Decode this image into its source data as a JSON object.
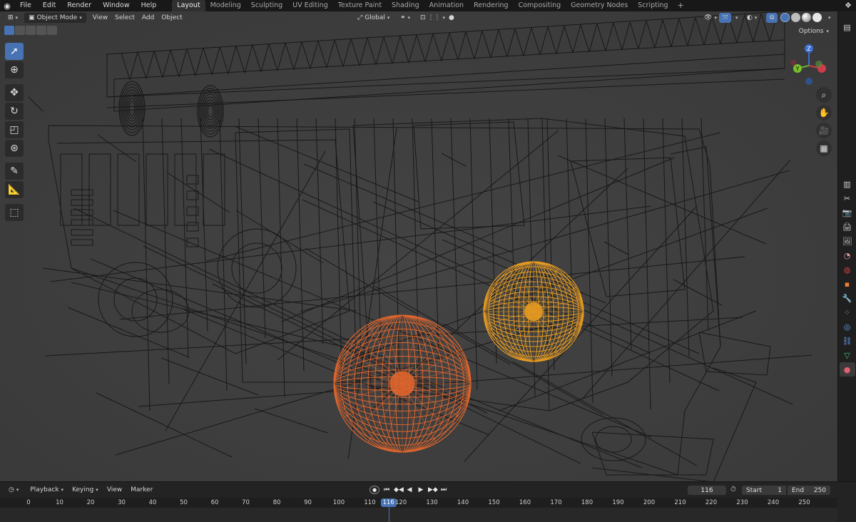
{
  "menu": {
    "items": [
      "File",
      "Edit",
      "Render",
      "Window",
      "Help"
    ]
  },
  "workspaces": {
    "tabs": [
      "Layout",
      "Modeling",
      "Sculpting",
      "UV Editing",
      "Texture Paint",
      "Shading",
      "Animation",
      "Rendering",
      "Compositing",
      "Geometry Nodes",
      "Scripting"
    ],
    "active": "Layout",
    "add_label": "+"
  },
  "viewport_header": {
    "mode_label": "Object Mode",
    "menus": [
      "View",
      "Select",
      "Add",
      "Object"
    ],
    "orientation_label": "Global",
    "options_label": "Options"
  },
  "gizmo": {
    "axis_z": "Z",
    "axis_y": "Y",
    "axis_x": "X"
  },
  "toolbar": {
    "tools": [
      "select-box",
      "cursor",
      "move",
      "rotate",
      "scale",
      "transform",
      "annotate",
      "measure",
      "add-cube"
    ],
    "active": "select-box"
  },
  "timeline": {
    "menus": [
      "Playback",
      "Keying",
      "View",
      "Marker"
    ],
    "current_frame": "116",
    "start_label": "Start",
    "start_value": "1",
    "end_label": "End",
    "end_value": "250",
    "ruler_ticks": [
      "0",
      "10",
      "20",
      "30",
      "40",
      "50",
      "60",
      "70",
      "80",
      "90",
      "100",
      "110",
      "120",
      "130",
      "140",
      "150",
      "160",
      "170",
      "180",
      "190",
      "200",
      "210",
      "220",
      "230",
      "240",
      "250"
    ],
    "playhead_label": "116"
  },
  "colors": {
    "accent": "#4772b3",
    "selected_orange": "#e8682c",
    "active_yellow": "#f0a020",
    "wire": "#111111",
    "viewport_bg": "#3d3d3d"
  }
}
